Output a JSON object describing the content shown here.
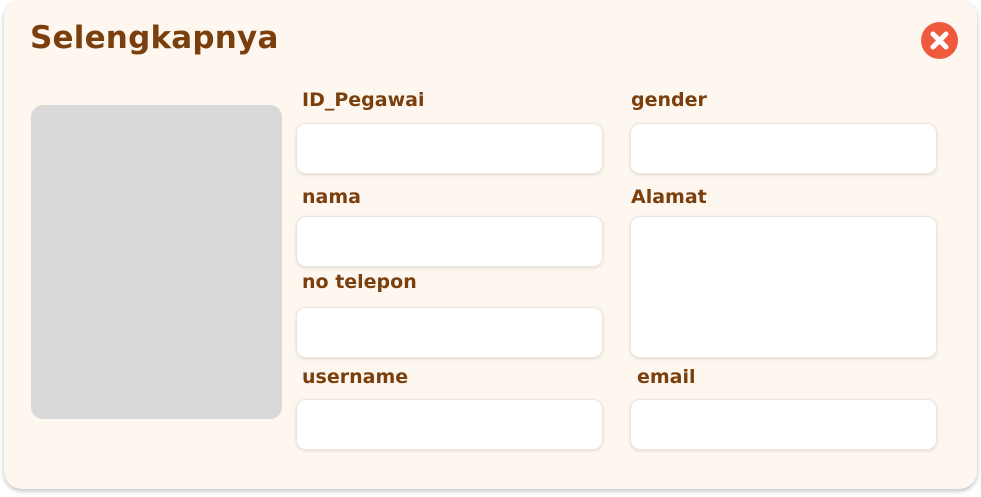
{
  "dialog": {
    "title": "Selengkapnya",
    "close_icon": "close-x-icon",
    "close_color": "#ef5a3e",
    "title_color": "#7a3f0d",
    "background": "#fdf7f0"
  },
  "photo": {
    "placeholder_color": "#d9d9d9"
  },
  "fields": {
    "id_pegawai": {
      "label": "ID_Pegawai",
      "value": ""
    },
    "gender": {
      "label": "gender",
      "value": ""
    },
    "nama": {
      "label": "nama",
      "value": ""
    },
    "alamat": {
      "label": "Alamat",
      "value": ""
    },
    "no_telepon": {
      "label": "no telepon",
      "value": ""
    },
    "username": {
      "label": "username",
      "value": ""
    },
    "email": {
      "label": "email",
      "value": ""
    }
  }
}
